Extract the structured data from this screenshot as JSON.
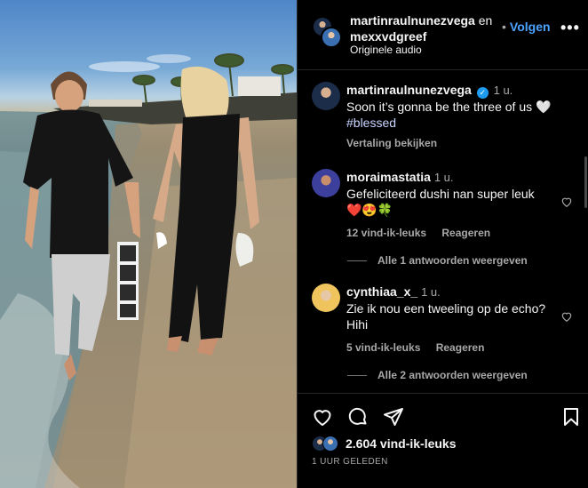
{
  "header": {
    "user1": "martinraulnunezvega",
    "conjunction": "en",
    "user2": "mexxvdgreef",
    "audio": "Originele audio",
    "follow_label": "Volgen",
    "more_label": "•••"
  },
  "caption": {
    "username": "martinraulnunezvega",
    "time": "1 u.",
    "text": "Soon it’s gonna be the three of us 🤍",
    "hashtag": "#blessed",
    "translate_label": "Vertaling bekijken"
  },
  "comments": [
    {
      "username": "moraimastatia",
      "time": "1 u.",
      "text": "Gefeliciteerd dushi nan super leuk",
      "emoji": "❤️😍🍀",
      "likes": "12 vind-ik-leuks",
      "reply_label": "Reageren",
      "view_replies": "Alle 1 antwoorden weergeven"
    },
    {
      "username": "cynthiaa_x_",
      "time": "1 u.",
      "text": "Zie ik nou een tweeling op de echo? Hihi",
      "likes": "5 vind-ik-leuks",
      "reply_label": "Reageren",
      "view_replies": "Alle 2 antwoorden weergeven"
    }
  ],
  "footer": {
    "likes": "2.604 vind-ik-leuks",
    "posted": "1 UUR GELEDEN"
  },
  "icons": {
    "like": "heart-icon",
    "comment": "comment-icon",
    "share": "send-icon",
    "save": "bookmark-icon"
  },
  "colors": {
    "accent": "#4aa3ff",
    "verified": "#1d9bf0",
    "background": "#000000"
  }
}
